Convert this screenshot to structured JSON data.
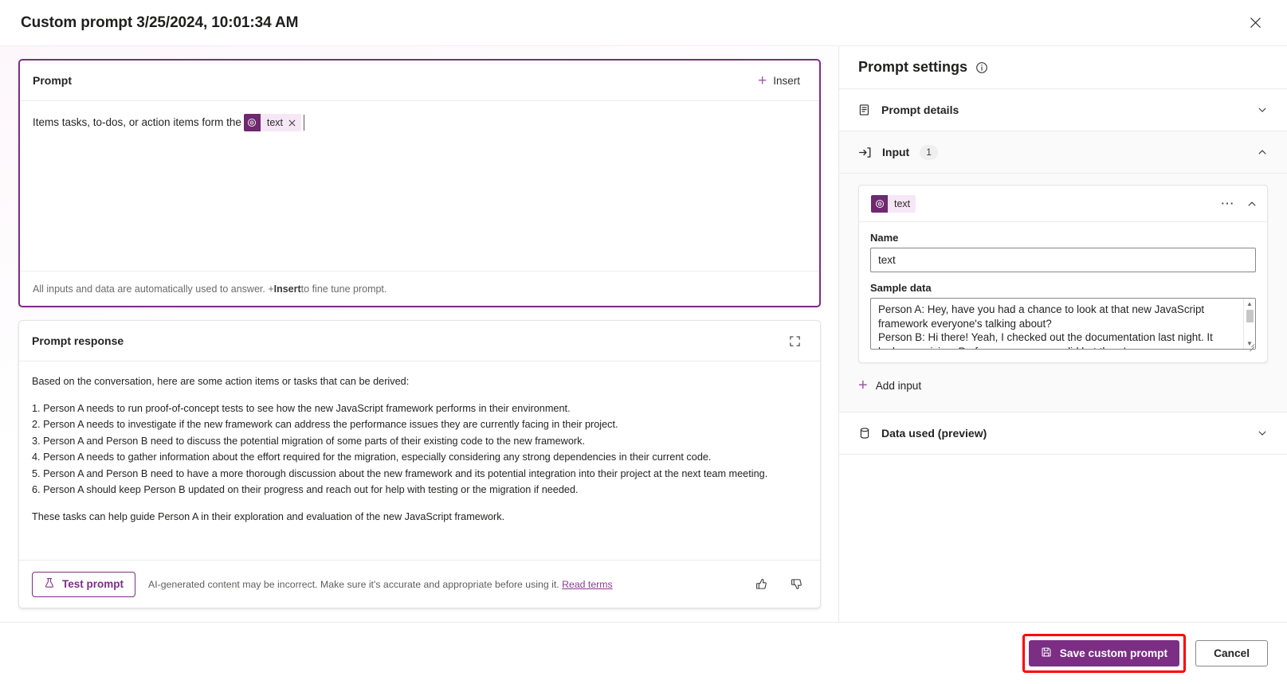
{
  "window": {
    "title": "Custom prompt 3/25/2024, 10:01:34 AM",
    "close_icon": "close-icon"
  },
  "prompt_card": {
    "header_label": "Prompt",
    "insert_label": "Insert",
    "insert_icon": "plus-icon",
    "text_before_chip": "Items tasks, to-dos, or action items form the",
    "chip": {
      "icon": "power-circle-icon",
      "label": "text",
      "remove_icon": "close-icon"
    },
    "footer_prefix": "All inputs and data are automatically used to answer. + ",
    "footer_bold": "Insert",
    "footer_suffix": " to fine tune prompt."
  },
  "response_card": {
    "header_label": "Prompt response",
    "expand_icon": "expand-icon",
    "intro": "Based on the conversation, here are some action items or tasks that can be derived:",
    "items": [
      "1. Person A needs to run proof-of-concept tests to see how the new JavaScript framework performs in their environment.",
      "2. Person A needs to investigate if the new framework can address the performance issues they are currently facing in their project.",
      "3. Person A and Person B need to discuss the potential migration of some parts of their existing code to the new framework.",
      "4. Person A needs to gather information about the effort required for the migration, especially considering any strong dependencies in their current code.",
      "5. Person A and Person B need to have a more thorough discussion about the new framework and its potential integration into their project at the next team meeting.",
      "6. Person A should keep Person B updated on their progress and reach out for help with testing or the migration if needed."
    ],
    "outro": "These tasks can help guide Person A in their exploration and evaluation of the new JavaScript framework.",
    "test_button_label": "Test prompt",
    "test_button_icon": "beaker-icon",
    "disclaimer": "AI-generated content may be incorrect. Make sure it's accurate and appropriate before using it.",
    "disclaimer_link": "Read terms",
    "thumbs_up_icon": "thumbs-up-icon",
    "thumbs_down_icon": "thumbs-down-icon"
  },
  "settings": {
    "title": "Prompt settings",
    "info_icon": "info-icon",
    "sections": [
      {
        "label": "Prompt details",
        "icon": "document-icon",
        "chevron": "chevron-down-icon",
        "expanded": false
      },
      {
        "label": "Input",
        "icon": "arrow-into-bracket-icon",
        "badge": "1",
        "chevron": "chevron-up-icon",
        "expanded": true
      },
      {
        "label": "Data used (preview)",
        "icon": "database-icon",
        "chevron": "chevron-down-icon",
        "expanded": false
      }
    ],
    "input_card": {
      "chip": {
        "icon": "power-circle-icon",
        "label": "text"
      },
      "overflow_icon": "more-horizontal-icon",
      "collapse_icon": "chevron-up-icon",
      "name_label": "Name",
      "name_value": "text",
      "name_placeholder": "Name",
      "sample_label": "Sample data",
      "sample_value": "Person A: Hey, have you had a chance to look at that new JavaScript framework everyone's talking about?\nPerson B: Hi there! Yeah, I checked out the documentation last night. It looks promising. Performance seems solid but there's a",
      "sample_placeholder": "Sample data",
      "scroll_up_icon": "caret-up-icon",
      "scroll_down_icon": "caret-down-icon"
    },
    "add_input_label": "Add input",
    "add_input_icon": "plus-icon"
  },
  "footer": {
    "save_label": "Save custom prompt",
    "save_icon": "save-icon",
    "cancel_label": "Cancel",
    "highlight_color": "#ff0000",
    "accent_color": "#7b2e84"
  }
}
